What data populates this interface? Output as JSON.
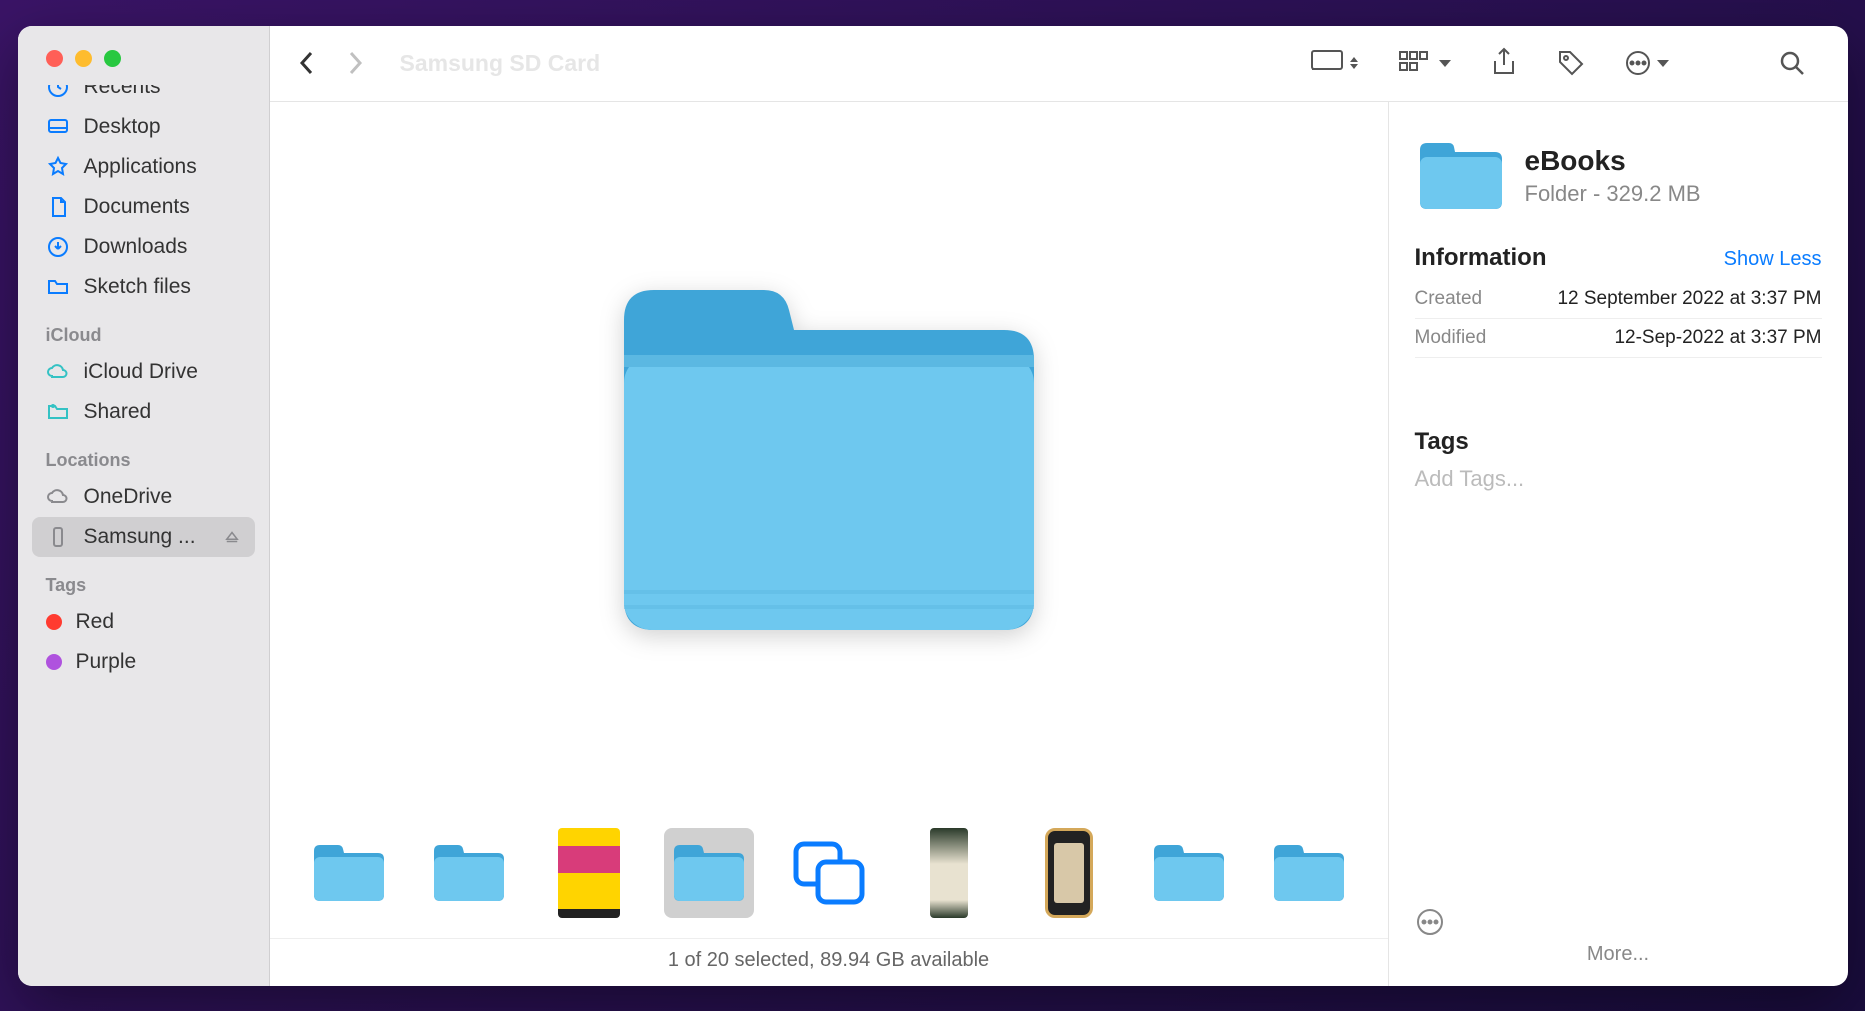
{
  "toolbar": {
    "title": "Samsung SD Card"
  },
  "sidebar": {
    "favorites": [
      {
        "label": "Recents",
        "icon": "clock"
      },
      {
        "label": "Desktop",
        "icon": "desktop"
      },
      {
        "label": "Applications",
        "icon": "apps"
      },
      {
        "label": "Documents",
        "icon": "doc"
      },
      {
        "label": "Downloads",
        "icon": "download"
      },
      {
        "label": "Sketch files",
        "icon": "folder"
      }
    ],
    "icloud_header": "iCloud",
    "icloud": [
      {
        "label": "iCloud Drive",
        "icon": "cloud"
      },
      {
        "label": "Shared",
        "icon": "shared"
      }
    ],
    "locations_header": "Locations",
    "locations": [
      {
        "label": "OneDrive",
        "icon": "cloud-gray"
      },
      {
        "label": "Samsung ...",
        "icon": "device",
        "selected": true,
        "eject": true
      }
    ],
    "tags_header": "Tags",
    "tags": [
      {
        "label": "Red",
        "color": "#ff3b30"
      },
      {
        "label": "Purple",
        "color": "#af52de"
      }
    ]
  },
  "info": {
    "name": "eBooks",
    "kind_size": "Folder - 329.2 MB",
    "section": "Information",
    "show_less": "Show Less",
    "created_label": "Created",
    "created_value": "12 September 2022 at 3:37 PM",
    "modified_label": "Modified",
    "modified_value": "12-Sep-2022 at 3:37 PM",
    "tags_title": "Tags",
    "add_tags": "Add Tags...",
    "more": "More..."
  },
  "status": "1 of 20 selected, 89.94 GB available",
  "thumbs": [
    {
      "type": "folder"
    },
    {
      "type": "folder"
    },
    {
      "type": "image-yellow"
    },
    {
      "type": "folder",
      "selected": true
    },
    {
      "type": "docs-icon"
    },
    {
      "type": "image-dark"
    },
    {
      "type": "image-phone"
    },
    {
      "type": "folder"
    },
    {
      "type": "folder"
    }
  ]
}
